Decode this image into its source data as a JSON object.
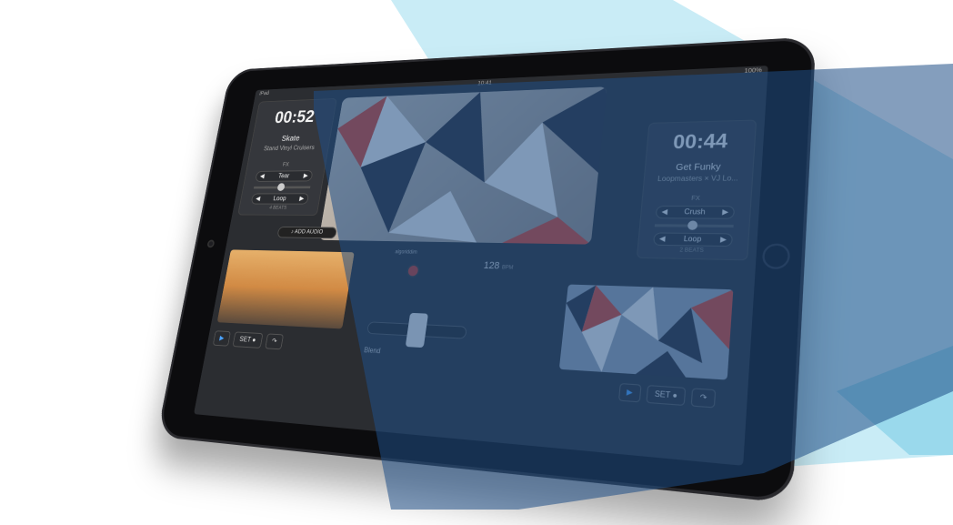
{
  "status": {
    "left": "iPad",
    "center": "10:41",
    "right": "100%"
  },
  "left_deck": {
    "time": "00:52",
    "track": "Skate",
    "artist": "Stand Vinyl Cruisers",
    "fx_label": "FX",
    "fx_value": "Tear",
    "loop_label": "Loop",
    "loop_sub": "4 BEATS"
  },
  "right_deck": {
    "time": "00:44",
    "track": "Get Funky",
    "artist": "Loopmasters × VJ Lo...",
    "fx_label": "FX",
    "fx_value": "Crush",
    "loop_label": "Loop",
    "loop_sub": "2 BEATS"
  },
  "mixer": {
    "add_audio": "ADD AUDIO",
    "bpm_value": "128",
    "bpm_unit": "BPM",
    "blend_label": "Blend",
    "watermark": "algoriddim"
  },
  "transport_left": {
    "play": "▶",
    "set": "SET ●",
    "loop_icon": "↷"
  },
  "transport_right": {
    "play": "▶",
    "set": "SET ●",
    "loop_icon": "↷"
  },
  "colors": {
    "accent_blue": "#4aa3ff",
    "overlay_light": "#bfe9f4",
    "overlay_dark": "#1f4f86",
    "triangle_red": "#d9432e"
  },
  "icons": [
    "camera-icon",
    "home-button-icon",
    "music-note-icon",
    "record-icon",
    "play-icon",
    "loop-icon",
    "scratch-icon"
  ]
}
